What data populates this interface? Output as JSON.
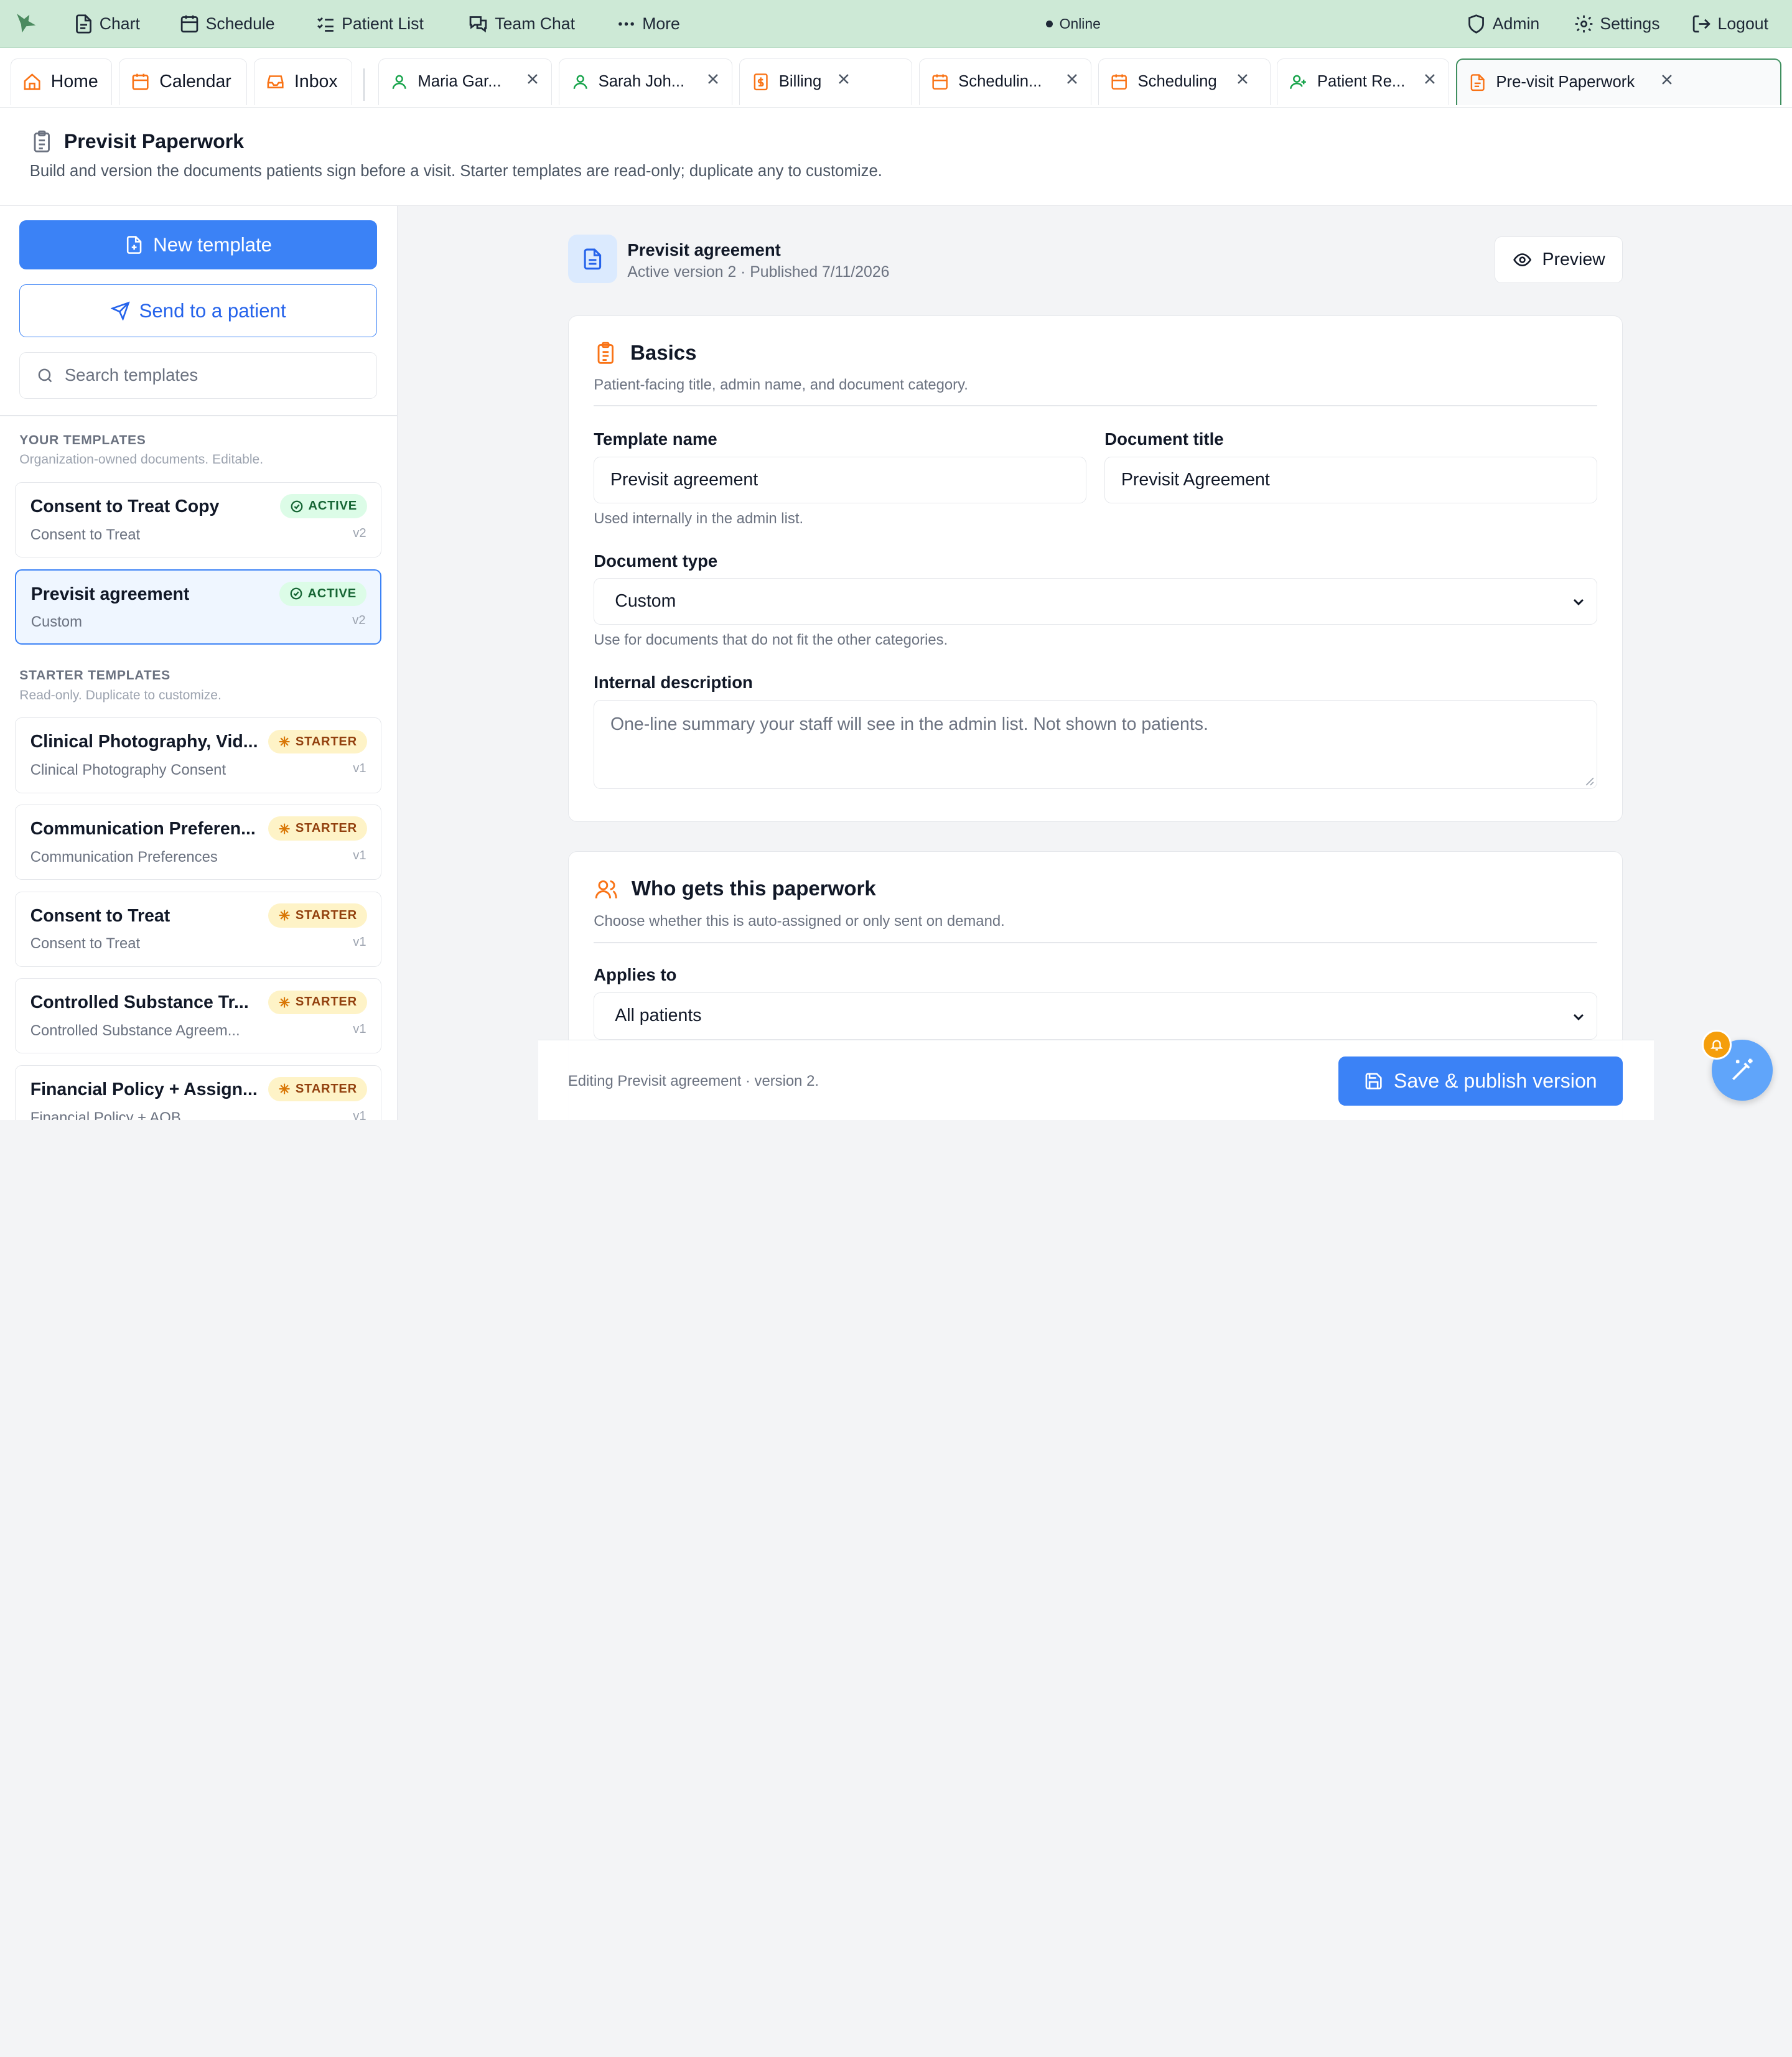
{
  "topnav": {
    "items": [
      {
        "label": "Chart",
        "icon": "file-text-icon"
      },
      {
        "label": "Schedule",
        "icon": "calendar-icon"
      },
      {
        "label": "Patient List",
        "icon": "list-checks-icon"
      },
      {
        "label": "Team Chat",
        "icon": "chat-icon"
      },
      {
        "label": "More",
        "icon": "dots-icon"
      }
    ],
    "status": "Online",
    "right": [
      {
        "label": "Admin",
        "icon": "shield-icon"
      },
      {
        "label": "Settings",
        "icon": "gear-icon"
      },
      {
        "label": "Logout",
        "icon": "logout-icon"
      }
    ]
  },
  "tabs": {
    "pinned": [
      "Home",
      "Calendar",
      "Inbox"
    ],
    "open": [
      "Maria Gar...",
      "Sarah Joh...",
      "Billing",
      "Schedulin...",
      "Scheduling",
      "Patient Re...",
      "Pre-visit Paperwork"
    ]
  },
  "page": {
    "title": "Previsit Paperwork",
    "subtitle": "Build and version the documents patients sign before a visit. Starter templates are read-only; duplicate any to customize."
  },
  "sidebar": {
    "new_template": "New template",
    "send_to_patient": "Send to a patient",
    "search_placeholder": "Search templates",
    "your_title": "YOUR TEMPLATES",
    "your_sub": "Organization-owned documents. Editable.",
    "your_templates": [
      {
        "title": "Consent to Treat Copy",
        "subtitle": "Consent to Treat",
        "badge": "ACTIVE",
        "version": "v2"
      },
      {
        "title": "Previsit agreement",
        "subtitle": "Custom",
        "badge": "ACTIVE",
        "version": "v2"
      }
    ],
    "starter_title": "STARTER TEMPLATES",
    "starter_sub": "Read-only. Duplicate to customize.",
    "starter_templates": [
      {
        "title": "Clinical Photography, Vid...",
        "subtitle": "Clinical Photography Consent",
        "badge": "STARTER",
        "version": "v1"
      },
      {
        "title": "Communication Preferen...",
        "subtitle": "Communication Preferences",
        "badge": "STARTER",
        "version": "v1"
      },
      {
        "title": "Consent to Treat",
        "subtitle": "Consent to Treat",
        "badge": "STARTER",
        "version": "v1"
      },
      {
        "title": "Controlled Substance Tr...",
        "subtitle": "Controlled Substance Agreem...",
        "badge": "STARTER",
        "version": "v1"
      },
      {
        "title": "Financial Policy + Assign...",
        "subtitle": "Financial Policy + AOB",
        "badge": "STARTER",
        "version": "v1"
      }
    ]
  },
  "document": {
    "title": "Previsit agreement",
    "meta": "Active version 2 · Published 7/11/2026",
    "preview": "Preview"
  },
  "basics": {
    "title": "Basics",
    "subtitle": "Patient-facing title, admin name, and document category.",
    "template_name_label": "Template name",
    "template_name_value": "Previsit agreement",
    "template_name_hint": "Used internally in the admin list.",
    "doc_title_label": "Document title",
    "doc_title_value": "Previsit Agreement",
    "doc_type_label": "Document type",
    "doc_type_value": "Custom",
    "doc_type_hint": "Use for documents that do not fit the other categories.",
    "desc_label": "Internal description",
    "desc_placeholder": "One-line summary your staff will see in the admin list. Not shown to patients."
  },
  "who": {
    "title": "Who gets this paperwork",
    "subtitle": "Choose whether this is auto-assigned or only sent on demand.",
    "applies_label": "Applies to",
    "applies_value": "All patients"
  },
  "footer": {
    "status": "Editing Previsit agreement · version 2.",
    "save": "Save & publish version"
  },
  "colors": {
    "primary": "#3b82f6",
    "topbar": "#cde9d6",
    "accent_orange": "#f97316",
    "active_tab": "#3f8f5f"
  }
}
